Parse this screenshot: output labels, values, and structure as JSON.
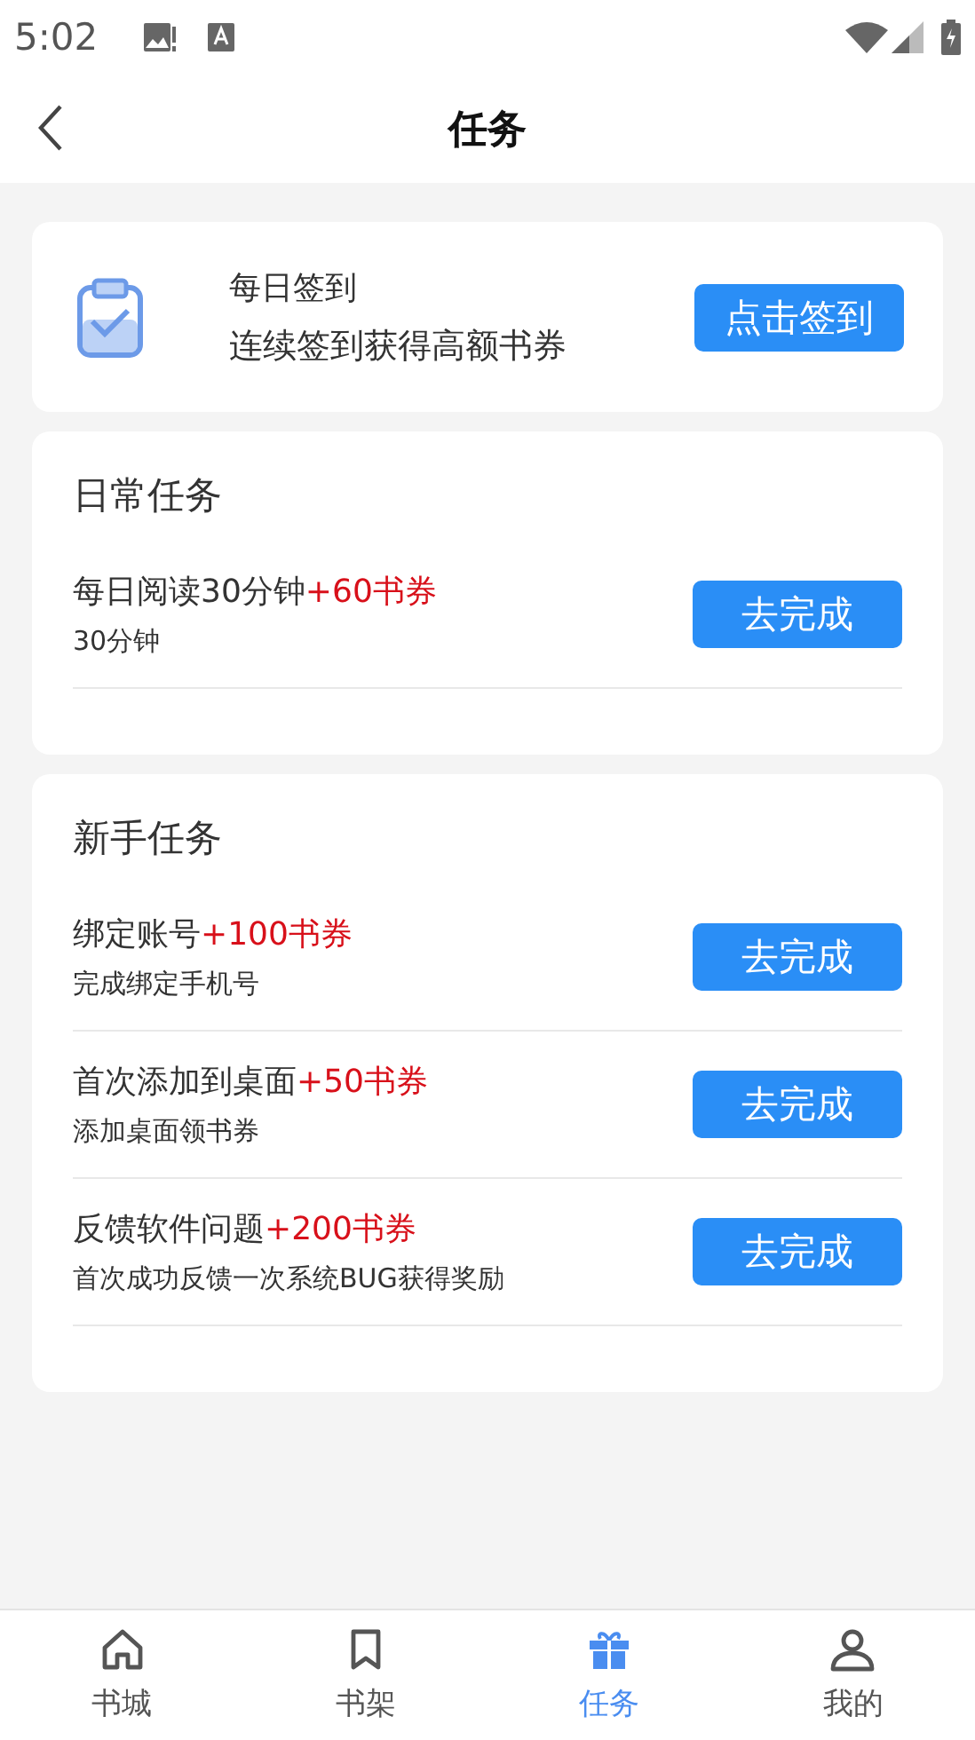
{
  "status_bar": {
    "time": "5:02"
  },
  "header": {
    "title": "任务"
  },
  "checkin": {
    "title": "每日签到",
    "subtitle": "连续签到获得高额书券",
    "button": "点击签到"
  },
  "sections": [
    {
      "title": "日常任务",
      "tasks": [
        {
          "title": "每日阅读30分钟",
          "reward": "+60书券",
          "desc": "30分钟",
          "button": "去完成"
        }
      ]
    },
    {
      "title": "新手任务",
      "tasks": [
        {
          "title": "绑定账号",
          "reward": "+100书券",
          "desc": "完成绑定手机号",
          "button": "去完成"
        },
        {
          "title": "首次添加到桌面",
          "reward": "+50书券",
          "desc": "添加桌面领书券",
          "button": "去完成"
        },
        {
          "title": "反馈软件问题",
          "reward": "+200书券",
          "desc": "首次成功反馈一次系统BUG获得奖励",
          "button": "去完成"
        }
      ]
    }
  ],
  "tabs": [
    {
      "kind": "home",
      "label": "书城",
      "selected": false
    },
    {
      "kind": "bookmark",
      "label": "书架",
      "selected": false
    },
    {
      "kind": "gift",
      "label": "任务",
      "selected": true
    },
    {
      "kind": "user",
      "label": "我的",
      "selected": false
    }
  ]
}
